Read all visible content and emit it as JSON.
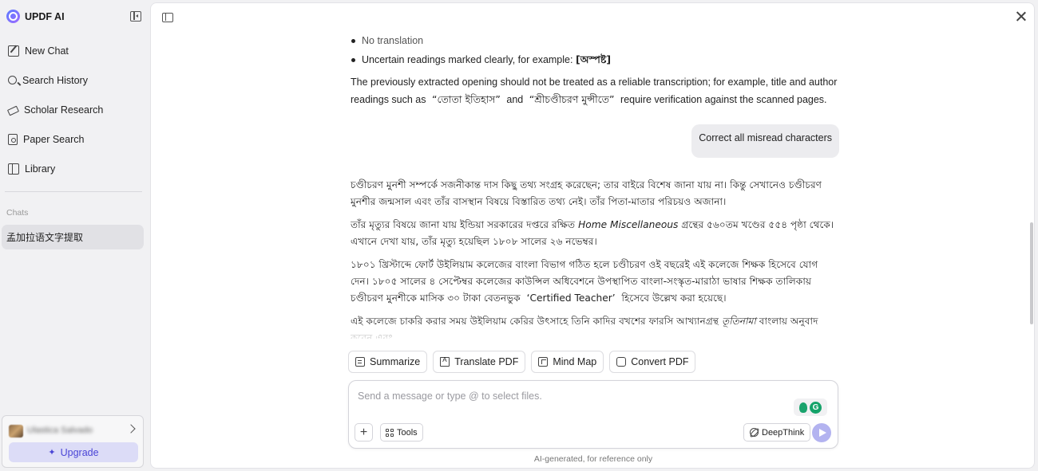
{
  "brand": {
    "name": "UPDF AI"
  },
  "sidebar": {
    "items": [
      {
        "label": "New Chat",
        "icon": "edit-icon"
      },
      {
        "label": "Search History",
        "icon": "search-icon"
      },
      {
        "label": "Scholar Research",
        "icon": "scholar-icon"
      },
      {
        "label": "Paper Search",
        "icon": "paper-search-icon"
      },
      {
        "label": "Library",
        "icon": "library-icon"
      }
    ],
    "chats_label": "Chats",
    "chats": [
      {
        "title": "孟加拉语文字提取"
      }
    ],
    "user": {
      "name": "Ulastica Salvado"
    },
    "upgrade_label": "Upgrade"
  },
  "conversation": {
    "bullet1": "No translation",
    "bullet2_text": "Uncertain readings marked clearly, for example: ",
    "bullet2_mark": "[অস্পষ্ট]",
    "para1_a": "The previously extracted opening should not be treated as a reliable transcription; for example, title and author readings such as",
    "para1_q1": "“তোতা ইতিহাস”",
    "para1_and": "and",
    "para1_q2": "“শ্রীচণ্ডীচরণ মুন্সীতে”",
    "para1_b": "require verification against the scanned pages.",
    "user_message": "Correct all misread characters",
    "bn_p1": "চণ্ডীচরণ মুনশী সম্পর্কে সজনীকান্ত দাস কিছু তথ্য সংগ্রহ করেছেন; তার বাইরে বিশেষ জানা যায় না। কিন্তু সেখানেও চণ্ডীচরণ মুনশীর জন্মসাল এবং তাঁর বাসস্থান বিষয়ে বিস্তারিত তথ্য নেই। তাঁর পিতা-মাতার পরিচয়ও অজানা।",
    "bn_p2_a": "তাঁর মৃত্যুর বিষয়ে জানা যায় ইন্ডিয়া সরকারের দপ্তরে রক্ষিত ",
    "bn_p2_italic": "Home Miscellaneous",
    "bn_p2_b": " গ্রন্থের ৫৬০তম খণ্ডের ৫৫৪ পৃষ্ঠা থেকে। এখানে দেখা যায়, তাঁর মৃত্যু হয়েছিল ১৮০৮ সালের ২৬ নভেম্বর।",
    "bn_p3_a": "১৮০১ খ্রিস্টাব্দে ফোর্ট উইলিয়াম কলেজের বাংলা বিভাগ গঠিত হলে চণ্ডীচরণ ওই বছরেই এই কলেজে শিক্ষক হিসেবে যোগ দেন। ১৮০৫ সালের ৪ সেপ্টেম্বর কলেজের কাউন্সিল অধিবেশনে উপস্থাপিত বাংলা-সংস্কৃত-মারাঠা ভাষার শিক্ষক তালিকায় চণ্ডীচরণ মুনশীকে মাসিক ৩০ টাকা বেতনভুক",
    "bn_p3_quote": "‘Certified Teacher’",
    "bn_p3_b": "হিসেবে উল্লেখ করা হয়েছে।",
    "bn_p4_a": "এই কলেজে চাকরি করার সময় উইলিয়াম কেরির উৎসাহে তিনি কাদির বখশের ফারসি আখ্যানগ্রন্থ ",
    "bn_p4_italic": "তূতিনামা",
    "bn_p4_b": " বাংলায় অনুবাদ করেন এবং"
  },
  "quick_actions": [
    {
      "label": "Summarize",
      "icon": "summarize-icon"
    },
    {
      "label": "Translate PDF",
      "icon": "translate-icon"
    },
    {
      "label": "Mind Map",
      "icon": "mind-map-icon"
    },
    {
      "label": "Convert PDF",
      "icon": "convert-icon"
    }
  ],
  "input": {
    "placeholder": "Send a message or type @ to select files.",
    "value": "",
    "tools_label": "Tools",
    "deepthink_label": "DeepThink"
  },
  "footer_note": "AI-generated, for reference only",
  "colors": {
    "accent": "#4a45d6",
    "upgrade_bg": "#dcdcf7",
    "send_bg": "#b3b3f0"
  }
}
